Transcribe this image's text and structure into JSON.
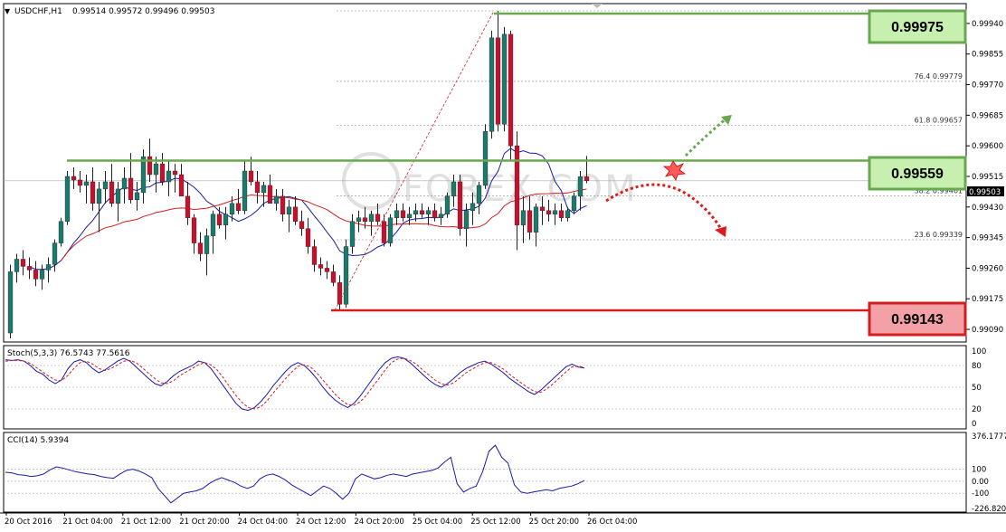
{
  "header": {
    "symbol": "USDCHF,H1",
    "ohlc": "0.99514 0.99572 0.99496 0.99503",
    "stoch_label": "Stoch(5,3,3) 76.5743 77.5616",
    "cci_label": "CCI(14) 5.9394"
  },
  "levels": {
    "resistance_high": "0.99975",
    "pivot": "0.99559",
    "support": "0.99143",
    "current_price": "0.99503"
  },
  "fib_levels": [
    {
      "label": "76.4  0.99779",
      "value": 0.99779
    },
    {
      "label": "61.8  0.99657",
      "value": 0.99657
    },
    {
      "label": "38.2  0.99461",
      "value": 0.99461
    },
    {
      "label": "23.6  0.99339",
      "value": 0.99339
    }
  ],
  "watermark": "FOREX.COM",
  "colors": {
    "bull": "#1a7a6c",
    "bear": "#c8102e",
    "ma_fast": "#1a1aa8",
    "ma_slow": "#d21e1e",
    "green_line": "#6aa84f",
    "red_line": "#d21e1e",
    "green_box": "#c6efb0",
    "red_box": "#f3a0a6"
  },
  "chart_data": {
    "type": "candlestick",
    "price_axis": {
      "ticks": [
        "0.99940",
        "0.99855",
        "0.99770",
        "0.99685",
        "0.99600",
        "0.99515",
        "0.99430",
        "0.99345",
        "0.99260",
        "0.99175",
        "0.99090"
      ],
      "ylim": [
        0.99065,
        0.99975
      ]
    },
    "x_labels": [
      "20 Oct 2016",
      "21 Oct 04:00",
      "21 Oct 12:00",
      "21 Oct 20:00",
      "24 Oct 04:00",
      "24 Oct 12:00",
      "24 Oct 20:00",
      "25 Oct 04:00",
      "25 Oct 12:00",
      "25 Oct 20:00",
      "26 Oct 04:00"
    ],
    "candles": [
      [
        0.9908,
        0.9927,
        0.99065,
        0.9925
      ],
      [
        0.9925,
        0.993,
        0.9922,
        0.99285
      ],
      [
        0.99285,
        0.9931,
        0.9924,
        0.99265
      ],
      [
        0.99265,
        0.9929,
        0.9923,
        0.99255
      ],
      [
        0.99255,
        0.9928,
        0.9921,
        0.9923
      ],
      [
        0.9923,
        0.9927,
        0.992,
        0.99255
      ],
      [
        0.99255,
        0.9929,
        0.9922,
        0.9927
      ],
      [
        0.9927,
        0.9934,
        0.9925,
        0.9933
      ],
      [
        0.9933,
        0.994,
        0.9932,
        0.9939
      ],
      [
        0.9939,
        0.9953,
        0.9938,
        0.99515
      ],
      [
        0.99515,
        0.9954,
        0.9948,
        0.99505
      ],
      [
        0.99505,
        0.9953,
        0.9947,
        0.9949
      ],
      [
        0.9949,
        0.9952,
        0.9944,
        0.995
      ],
      [
        0.995,
        0.9954,
        0.9942,
        0.9944
      ],
      [
        0.9944,
        0.995,
        0.9936,
        0.9948
      ],
      [
        0.9948,
        0.9953,
        0.9944,
        0.995
      ],
      [
        0.995,
        0.9955,
        0.9943,
        0.9944
      ],
      [
        0.9944,
        0.995,
        0.9939,
        0.9948
      ],
      [
        0.9948,
        0.9954,
        0.9944,
        0.9951
      ],
      [
        0.9951,
        0.9958,
        0.9944,
        0.9945
      ],
      [
        0.9945,
        0.995,
        0.9942,
        0.9947
      ],
      [
        0.9947,
        0.9959,
        0.9944,
        0.9957
      ],
      [
        0.9957,
        0.9962,
        0.995,
        0.9952
      ],
      [
        0.9952,
        0.9957,
        0.9947,
        0.9955
      ],
      [
        0.9955,
        0.9958,
        0.9949,
        0.995
      ],
      [
        0.995,
        0.9956,
        0.9946,
        0.9953
      ],
      [
        0.9953,
        0.9955,
        0.9947,
        0.9952
      ],
      [
        0.9952,
        0.9955,
        0.9949,
        0.9946
      ],
      [
        0.9946,
        0.995,
        0.9938,
        0.994
      ],
      [
        0.994,
        0.9941,
        0.993,
        0.9933
      ],
      [
        0.9933,
        0.9936,
        0.9928,
        0.993
      ],
      [
        0.993,
        0.9937,
        0.9924,
        0.9935
      ],
      [
        0.9935,
        0.9942,
        0.993,
        0.9941
      ],
      [
        0.9941,
        0.9943,
        0.9937,
        0.9938
      ],
      [
        0.9938,
        0.9943,
        0.9934,
        0.9941
      ],
      [
        0.9941,
        0.9946,
        0.9939,
        0.9944
      ],
      [
        0.9944,
        0.9948,
        0.9941,
        0.9942
      ],
      [
        0.9942,
        0.9956,
        0.9941,
        0.9953
      ],
      [
        0.9953,
        0.9957,
        0.9949,
        0.995
      ],
      [
        0.995,
        0.9953,
        0.9944,
        0.9947
      ],
      [
        0.9947,
        0.995,
        0.9943,
        0.9949
      ],
      [
        0.9949,
        0.9952,
        0.9945,
        0.9944
      ],
      [
        0.9944,
        0.9948,
        0.9942,
        0.9946
      ],
      [
        0.9946,
        0.9948,
        0.9939,
        0.9941
      ],
      [
        0.9941,
        0.9945,
        0.9936,
        0.9943
      ],
      [
        0.9943,
        0.9946,
        0.9938,
        0.9939
      ],
      [
        0.9939,
        0.9942,
        0.9935,
        0.9937
      ],
      [
        0.9937,
        0.994,
        0.993,
        0.9932
      ],
      [
        0.9932,
        0.9934,
        0.9925,
        0.9927
      ],
      [
        0.9927,
        0.9929,
        0.9924,
        0.9926
      ],
      [
        0.9926,
        0.9928,
        0.9923,
        0.9925
      ],
      [
        0.9925,
        0.9927,
        0.9921,
        0.9922
      ],
      [
        0.9922,
        0.9924,
        0.99143,
        0.9916
      ],
      [
        0.9916,
        0.9934,
        0.9915,
        0.9932
      ],
      [
        0.9932,
        0.9941,
        0.993,
        0.9939
      ],
      [
        0.9939,
        0.9942,
        0.9936,
        0.994
      ],
      [
        0.994,
        0.9943,
        0.9937,
        0.9939
      ],
      [
        0.9939,
        0.9942,
        0.9935,
        0.9941
      ],
      [
        0.9941,
        0.9944,
        0.9938,
        0.9939
      ],
      [
        0.9939,
        0.9941,
        0.9932,
        0.9933
      ],
      [
        0.9933,
        0.9941,
        0.9932,
        0.994
      ],
      [
        0.994,
        0.9944,
        0.9938,
        0.9942
      ],
      [
        0.9942,
        0.9944,
        0.9939,
        0.994
      ],
      [
        0.994,
        0.9943,
        0.9938,
        0.9941
      ],
      [
        0.9941,
        0.9944,
        0.9939,
        0.9942
      ],
      [
        0.9942,
        0.9944,
        0.994,
        0.9941
      ],
      [
        0.9941,
        0.9943,
        0.9938,
        0.9942
      ],
      [
        0.9942,
        0.9944,
        0.9939,
        0.994
      ],
      [
        0.994,
        0.9943,
        0.9938,
        0.9941
      ],
      [
        0.9941,
        0.9947,
        0.994,
        0.9946
      ],
      [
        0.9946,
        0.9952,
        0.9943,
        0.995
      ],
      [
        0.995,
        0.9952,
        0.9935,
        0.9937
      ],
      [
        0.9937,
        0.9944,
        0.9932,
        0.9942
      ],
      [
        0.9942,
        0.9947,
        0.9938,
        0.9944
      ],
      [
        0.9944,
        0.995,
        0.9941,
        0.9949
      ],
      [
        0.9949,
        0.9966,
        0.9948,
        0.9964
      ],
      [
        0.9964,
        0.9992,
        0.9962,
        0.999
      ],
      [
        0.999,
        0.99975,
        0.9964,
        0.9966
      ],
      [
        0.9966,
        0.9993,
        0.9964,
        0.9991
      ],
      [
        0.9991,
        0.9992,
        0.9956,
        0.996
      ],
      [
        0.996,
        0.9964,
        0.9931,
        0.9938
      ],
      [
        0.9938,
        0.9946,
        0.9933,
        0.9942
      ],
      [
        0.9942,
        0.9946,
        0.9934,
        0.9936
      ],
      [
        0.9936,
        0.9944,
        0.9932,
        0.9943
      ],
      [
        0.9943,
        0.9946,
        0.9938,
        0.9942
      ],
      [
        0.9942,
        0.9945,
        0.9939,
        0.9941
      ],
      [
        0.9941,
        0.9944,
        0.9938,
        0.9942
      ],
      [
        0.9942,
        0.9944,
        0.9939,
        0.994
      ],
      [
        0.994,
        0.9943,
        0.9939,
        0.9942
      ],
      [
        0.9942,
        0.9947,
        0.9941,
        0.9946
      ],
      [
        0.9946,
        0.9953,
        0.9942,
        0.99514
      ],
      [
        0.99514,
        0.99572,
        0.99496,
        0.99503
      ]
    ],
    "stoch": {
      "ticks": [
        "100",
        "80",
        "50",
        "20",
        "0"
      ],
      "main": [
        88,
        87,
        88,
        86,
        80,
        72,
        68,
        60,
        55,
        60,
        75,
        85,
        88,
        84,
        76,
        70,
        74,
        80,
        86,
        90,
        86,
        78,
        70,
        62,
        55,
        52,
        58,
        66,
        72,
        76,
        80,
        86,
        84,
        76,
        64,
        52,
        40,
        28,
        20,
        18,
        22,
        30,
        40,
        52,
        62,
        72,
        80,
        84,
        80,
        72,
        62,
        50,
        40,
        32,
        26,
        22,
        28,
        38,
        50,
        62,
        74,
        84,
        90,
        92,
        90,
        84,
        76,
        68,
        60,
        54,
        50,
        55,
        62,
        70,
        76,
        80,
        84,
        86,
        82,
        76,
        70,
        62,
        56,
        50,
        44,
        40,
        46,
        54,
        62,
        70,
        78,
        82,
        78,
        76.5743
      ],
      "signal": [
        86,
        87,
        87,
        86,
        83,
        77,
        71,
        65,
        60,
        59,
        66,
        76,
        84,
        86,
        82,
        76,
        73,
        76,
        81,
        86,
        87,
        84,
        77,
        69,
        62,
        56,
        55,
        59,
        66,
        71,
        76,
        81,
        84,
        81,
        74,
        63,
        51,
        39,
        29,
        22,
        20,
        23,
        31,
        42,
        52,
        62,
        71,
        79,
        81,
        78,
        70,
        60,
        50,
        40,
        32,
        26,
        25,
        30,
        39,
        51,
        62,
        74,
        84,
        89,
        90,
        87,
        82,
        74,
        67,
        60,
        55,
        53,
        56,
        63,
        70,
        75,
        80,
        84,
        84,
        80,
        75,
        68,
        61,
        55,
        49,
        44,
        43,
        48,
        55,
        63,
        71,
        78,
        79,
        77.5616
      ]
    },
    "cci": {
      "ticks": [
        "376.1777",
        "100",
        "0.00",
        "-100",
        "-226.8201"
      ],
      "values": [
        75,
        70,
        55,
        50,
        40,
        45,
        60,
        95,
        120,
        110,
        95,
        80,
        70,
        60,
        55,
        40,
        30,
        25,
        60,
        90,
        100,
        85,
        60,
        30,
        -60,
        -120,
        -180,
        -140,
        -100,
        -90,
        -80,
        -60,
        -20,
        10,
        30,
        10,
        -10,
        -40,
        -60,
        -40,
        20,
        50,
        60,
        40,
        10,
        -30,
        -60,
        -90,
        -120,
        -80,
        -40,
        -60,
        -100,
        -150,
        -100,
        20,
        60,
        40,
        20,
        30,
        50,
        60,
        50,
        40,
        60,
        70,
        80,
        90,
        110,
        160,
        200,
        -20,
        -90,
        -60,
        -40,
        80,
        250,
        300,
        200,
        150,
        -30,
        -90,
        -100,
        -90,
        -80,
        -70,
        -80,
        -60,
        -50,
        -40,
        -20,
        5.9394
      ]
    }
  }
}
